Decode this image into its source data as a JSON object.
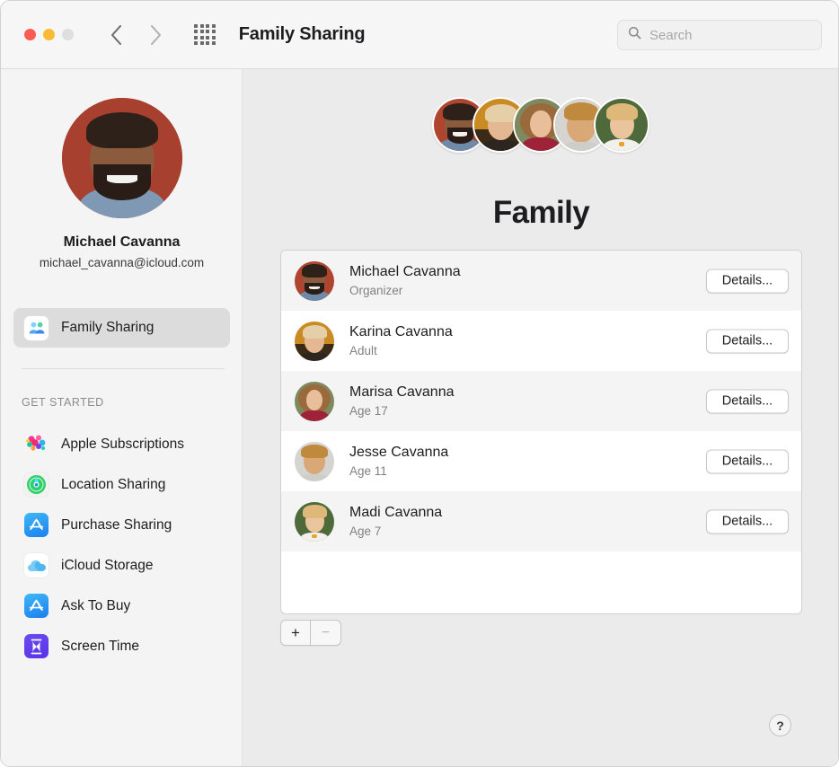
{
  "window": {
    "title": "Family Sharing",
    "traffic_lights": [
      "close",
      "minimize",
      "zoom"
    ],
    "nav": {
      "back": "back-arrow",
      "forward": "forward-arrow"
    },
    "grid_button": "all-preferences-grid"
  },
  "search": {
    "placeholder": "Search",
    "value": "",
    "icon": "search-icon"
  },
  "sidebar": {
    "profile": {
      "name": "Michael Cavanna",
      "email": "michael_cavanna@icloud.com",
      "avatar": "michael-avatar"
    },
    "selected_item": {
      "label": "Family Sharing",
      "icon": "family-sharing-icon"
    },
    "section_label": "GET STARTED",
    "items": [
      {
        "label": "Apple Subscriptions",
        "icon": "apple-subscriptions-icon"
      },
      {
        "label": "Location Sharing",
        "icon": "find-my-icon"
      },
      {
        "label": "Purchase Sharing",
        "icon": "app-store-icon"
      },
      {
        "label": "iCloud Storage",
        "icon": "icloud-icon"
      },
      {
        "label": "Ask To Buy",
        "icon": "app-store-icon"
      },
      {
        "label": "Screen Time",
        "icon": "screen-time-icon"
      }
    ]
  },
  "main": {
    "heading": "Family",
    "cluster_avatars": [
      "michael",
      "karina",
      "marisa",
      "jesse",
      "madi"
    ],
    "members": [
      {
        "name": "Michael Cavanna",
        "role": "Organizer",
        "details_label": "Details...",
        "avatar": "michael"
      },
      {
        "name": "Karina Cavanna",
        "role": "Adult",
        "details_label": "Details...",
        "avatar": "karina"
      },
      {
        "name": "Marisa Cavanna",
        "role": "Age 17",
        "details_label": "Details...",
        "avatar": "marisa"
      },
      {
        "name": "Jesse Cavanna",
        "role": "Age 11",
        "details_label": "Details...",
        "avatar": "jesse"
      },
      {
        "name": "Madi Cavanna",
        "role": "Age 7",
        "details_label": "Details...",
        "avatar": "madi"
      }
    ],
    "add_label": "+",
    "remove_label": "−",
    "help_label": "?"
  },
  "colors": {
    "accent_blue": "#1a7ff0",
    "sidebar_bg": "#f4f4f4",
    "content_bg": "#ebebeb",
    "selected_row": "#dcdcdc",
    "traffic_red": "#fc5c54",
    "traffic_yellow": "#f8bc34",
    "traffic_gray": "#dedede"
  }
}
